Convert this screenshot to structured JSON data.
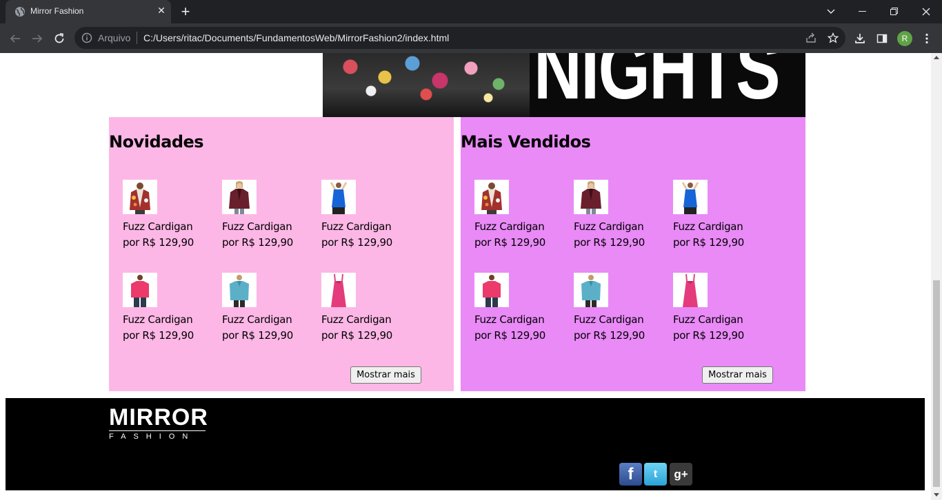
{
  "browser": {
    "tab_title": "Mirror Fashion",
    "new_tab_symbol": "+",
    "close_symbol": "✕",
    "omnibox_scheme": "Arquivo",
    "url": "C:/Users/ritac/Documents/FundamentosWeb/MirrorFashion2/index.html",
    "profile_initial": "R",
    "profile_color": "#5fa346"
  },
  "banner": {
    "text": "NIGHTS"
  },
  "sections": [
    {
      "title": "Novidades",
      "background": "#fdb7e6",
      "products": [
        {
          "name": "Fuzz Cardigan",
          "price": "por R$ 129,90",
          "image": "printed-jacket"
        },
        {
          "name": "Fuzz Cardigan",
          "price": "por R$ 129,90",
          "image": "burgundy-jacket"
        },
        {
          "name": "Fuzz Cardigan",
          "price": "por R$ 129,90",
          "image": "blue-tank-top"
        },
        {
          "name": "Fuzz Cardigan",
          "price": "por R$ 129,90",
          "image": "pink-top"
        },
        {
          "name": "Fuzz Cardigan",
          "price": "por R$ 129,90",
          "image": "teal-blouse"
        },
        {
          "name": "Fuzz Cardigan",
          "price": "por R$ 129,90",
          "image": "pink-dress"
        }
      ],
      "button_label": "Mostrar mais"
    },
    {
      "title": "Mais Vendidos",
      "background": "#e98af7",
      "products": [
        {
          "name": "Fuzz Cardigan",
          "price": "por R$ 129,90",
          "image": "printed-jacket"
        },
        {
          "name": "Fuzz Cardigan",
          "price": "por R$ 129,90",
          "image": "burgundy-jacket"
        },
        {
          "name": "Fuzz Cardigan",
          "price": "por R$ 129,90",
          "image": "blue-tank-top"
        },
        {
          "name": "Fuzz Cardigan",
          "price": "por R$ 129,90",
          "image": "pink-top"
        },
        {
          "name": "Fuzz Cardigan",
          "price": "por R$ 129,90",
          "image": "teal-blouse"
        },
        {
          "name": "Fuzz Cardigan",
          "price": "por R$ 129,90",
          "image": "pink-dress"
        }
      ],
      "button_label": "Mostrar mais"
    }
  ],
  "footer": {
    "logo_main": "MIRRОR",
    "logo_sub": "FASHION",
    "social": [
      {
        "icon": "facebook-icon",
        "glyph": "f",
        "color": "#3b5998"
      },
      {
        "icon": "twitter-icon",
        "glyph": "t",
        "color": "#33b5e5"
      },
      {
        "icon": "google-plus-icon",
        "glyph": "g+",
        "color": "#3a3a3a"
      }
    ]
  }
}
